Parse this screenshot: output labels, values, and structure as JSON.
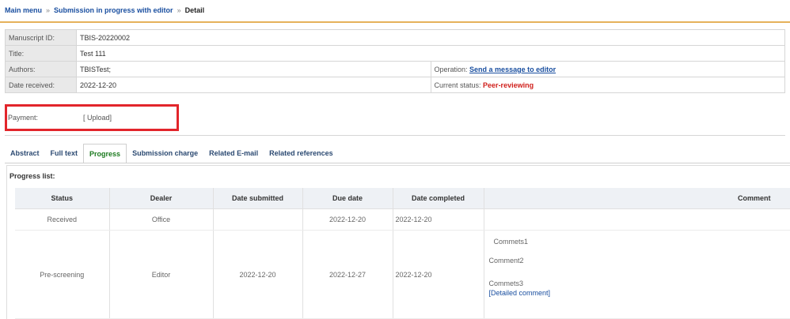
{
  "breadcrumb": {
    "items": [
      "Main menu",
      "Submission in progress with editor",
      "Detail"
    ],
    "separator": "»"
  },
  "manuscript": {
    "id_label": "Manuscript ID:",
    "id_value": "TBIS-20220002",
    "title_label": "Title:",
    "title_value": "Test 111",
    "authors_label": "Authors:",
    "authors_value": "TBISTest;",
    "date_label": "Date received:",
    "date_value": "2022-12-20",
    "payment_label": "Payment:",
    "payment_value": "[ Upload]"
  },
  "operation": {
    "label": "Operation:",
    "link": "Send a message to editor",
    "status_label": "Current status:",
    "status_value": "Peer-reviewing"
  },
  "tabs": [
    "Abstract",
    "Full text",
    "Progress",
    "Submission charge",
    "Related E-mail",
    "Related references"
  ],
  "active_tab": "Progress",
  "progress": {
    "title": "Progress list:",
    "columns": [
      "Status",
      "Dealer",
      "Date submitted",
      "Due date",
      "Date completed",
      "Comment"
    ],
    "rows": [
      {
        "status": "Received",
        "dealer": "Office",
        "submitted": "",
        "due": "2022-12-20",
        "completed": "2022-12-20"
      },
      {
        "status": "Pre-screening",
        "dealer": "Editor",
        "submitted": "2022-12-20",
        "due": "2022-12-27",
        "completed": "2022-12-20",
        "comments": [
          "Commets1",
          "Comment2",
          "Commets3"
        ],
        "detail_link": "[Detailed comment]"
      }
    ]
  },
  "colors": {
    "accent_rule": "#e6b25a",
    "highlight": "#e2252b",
    "status": "#d0201c",
    "active_tab": "#1c7a1f",
    "link": "#1a4fa0"
  }
}
